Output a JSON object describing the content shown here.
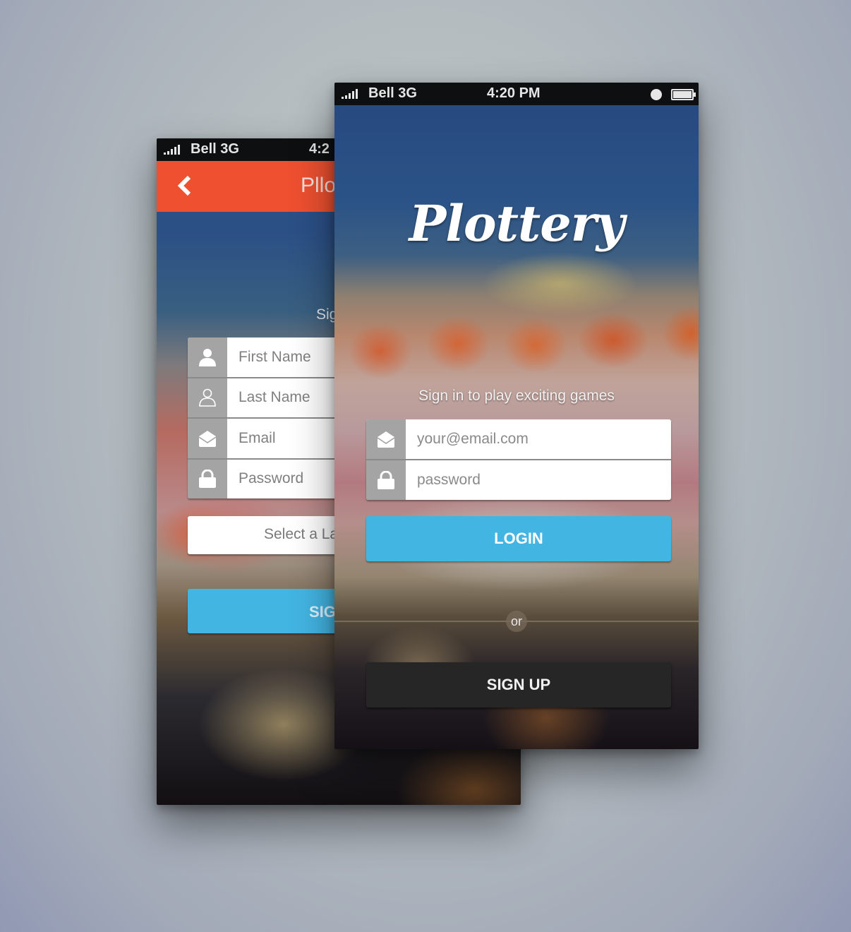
{
  "colors": {
    "accent_blue": "#43b5e3",
    "header_orange": "#ee5030",
    "dark_button": "#262626",
    "icon_tile_gray": "#a4a4a4"
  },
  "back_screen": {
    "status_bar": {
      "carrier": "Bell 3G",
      "time": "4:2"
    },
    "app_bar": {
      "back_icon": "chevron-left-icon",
      "title": "Pllo"
    },
    "signup_hint": "Sig",
    "fields": [
      {
        "icon": "user-filled-icon",
        "placeholder": "First Name"
      },
      {
        "icon": "user-outline-icon",
        "placeholder": "Last Name"
      },
      {
        "icon": "envelope-open-icon",
        "placeholder": "Email"
      },
      {
        "icon": "lock-icon",
        "placeholder": "Password"
      }
    ],
    "language_select": "Select a Lar",
    "signup_button": "SIG"
  },
  "front_screen": {
    "status_bar": {
      "carrier": "Bell 3G",
      "time": "4:20 PM"
    },
    "brand": "Plottery",
    "tagline": "Sign in to play exciting games",
    "fields": [
      {
        "icon": "envelope-open-icon",
        "placeholder": "your@email.com"
      },
      {
        "icon": "lock-icon",
        "placeholder": "password"
      }
    ],
    "login_button": "LOGIN",
    "divider_label": "or",
    "signup_button": "SIGN UP"
  }
}
